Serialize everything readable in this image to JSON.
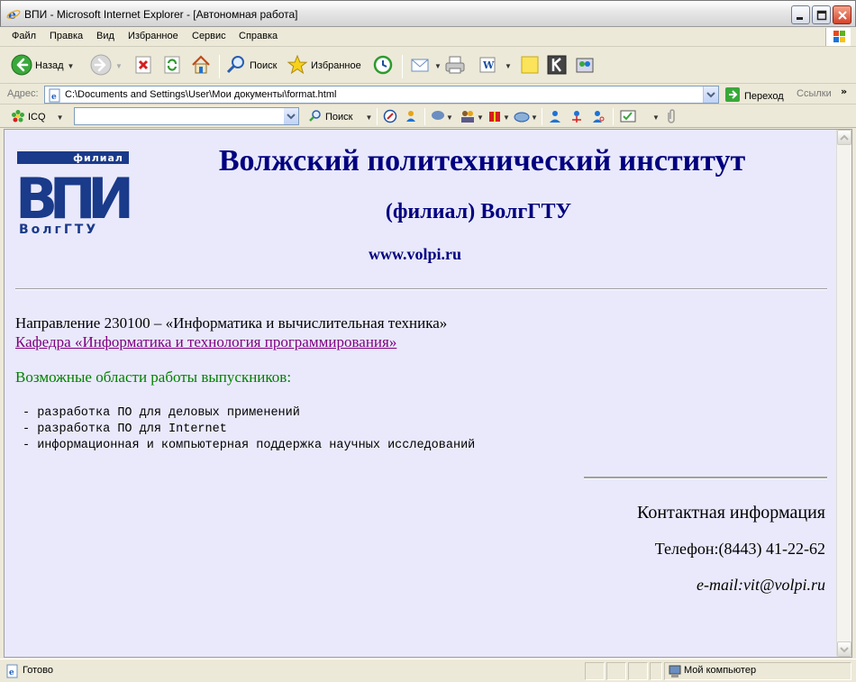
{
  "window": {
    "title": "ВПИ - Microsoft Internet Explorer - [Автономная работа]"
  },
  "menu": {
    "items": [
      "Файл",
      "Правка",
      "Вид",
      "Избранное",
      "Сервис",
      "Справка"
    ]
  },
  "toolbar": {
    "back_label": "Назад",
    "search_label": "Поиск",
    "favorites_label": "Избранное"
  },
  "address": {
    "label": "Адрес:",
    "url": "C:\\Documents and Settings\\User\\Мои документы\\format.html",
    "go_label": "Переход",
    "links_label": "Ссылки"
  },
  "icq": {
    "label": "ICQ",
    "search_label": "Поиск"
  },
  "page": {
    "logo": {
      "top_text": "филиал",
      "main_text": "ВПИ",
      "bottom_text": "ВолгГТУ"
    },
    "title": "Волжский политехнический институт",
    "subtitle": "(филиал) ВолгГТУ",
    "site_url": "www.volpi.ru",
    "direction": "Направление 230100 – «Информатика и вычислительная техника»",
    "department_link": "Кафедра «Информатика и технология программирования»",
    "areas_title": "Возможные области работы выпускников:",
    "areas": [
      "- разработка ПО для деловых применений",
      "- разработка ПО для Internet",
      "- информационная и компьютерная поддержка научных исследований"
    ],
    "contact_title": "Контактная информация",
    "phone": "Телефон:(8443) 41-22-62",
    "email": "e-mail:vit@volpi.ru"
  },
  "status": {
    "left_text": "Готово",
    "zone_text": "Мой компьютер"
  },
  "colors": {
    "page_background": "#e9e9fb",
    "title_color": "#000080",
    "link_color": "#800080",
    "areas_title_color": "#008000",
    "logo_color": "#1a3a8a"
  }
}
